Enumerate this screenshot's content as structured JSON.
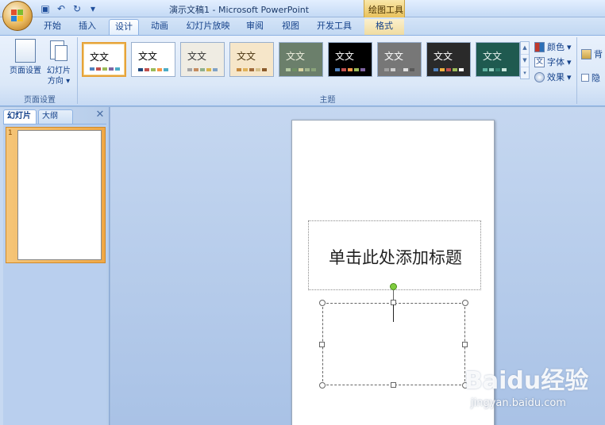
{
  "window": {
    "title": "演示文稿1 - Microsoft PowerPoint",
    "context_tab_head": "绘图工具"
  },
  "quick_access": {
    "icons": [
      "save-icon",
      "undo-icon",
      "redo-icon",
      "customize-icon"
    ]
  },
  "tabs": [
    {
      "label": "开始"
    },
    {
      "label": "插入"
    },
    {
      "label": "设计"
    },
    {
      "label": "动画"
    },
    {
      "label": "幻灯片放映"
    },
    {
      "label": "审阅"
    },
    {
      "label": "视图"
    },
    {
      "label": "开发工具"
    },
    {
      "label": "格式"
    }
  ],
  "active_tab": "设计",
  "ribbon": {
    "page_setup": {
      "page_setup_label": "页面设置",
      "orientation_label_1": "幻灯片",
      "orientation_label_2": "方向",
      "group_label": "页面设置"
    },
    "themes": {
      "group_label": "主题",
      "items": [
        {
          "text": "文文",
          "bg": "#ffffff",
          "fg": "#000000",
          "selected": true
        },
        {
          "text": "文文",
          "bg": "#ffffff",
          "fg": "#000000"
        },
        {
          "text": "文文",
          "bg": "#efece3",
          "fg": "#333333"
        },
        {
          "text": "文文",
          "bg": "#f6e6c9",
          "fg": "#4a3510"
        },
        {
          "text": "文文",
          "bg": "#6b7f6b",
          "fg": "#f0f0e0"
        },
        {
          "text": "文文",
          "bg": "#000000",
          "fg": "#ffffff"
        },
        {
          "text": "文文",
          "bg": "#777777",
          "fg": "#ffffff"
        },
        {
          "text": "文文",
          "bg": "#2a2a2a",
          "fg": "#ffffff"
        },
        {
          "text": "文文",
          "bg": "#1f5a50",
          "fg": "#e8f2ee"
        }
      ],
      "colors_label": "颜色",
      "fonts_label": "字体",
      "effects_label": "效果"
    },
    "background": {
      "styles_label": "背",
      "hide_label": "隐"
    }
  },
  "left_panel": {
    "tab_slides": "幻灯片",
    "tab_outline": "大纲",
    "close_label": "✕",
    "slide_number": "1"
  },
  "slide": {
    "title_placeholder": "单击此处添加标题"
  },
  "watermark": {
    "brand": "Baidu经验",
    "url": "jingyan.baidu.com"
  }
}
